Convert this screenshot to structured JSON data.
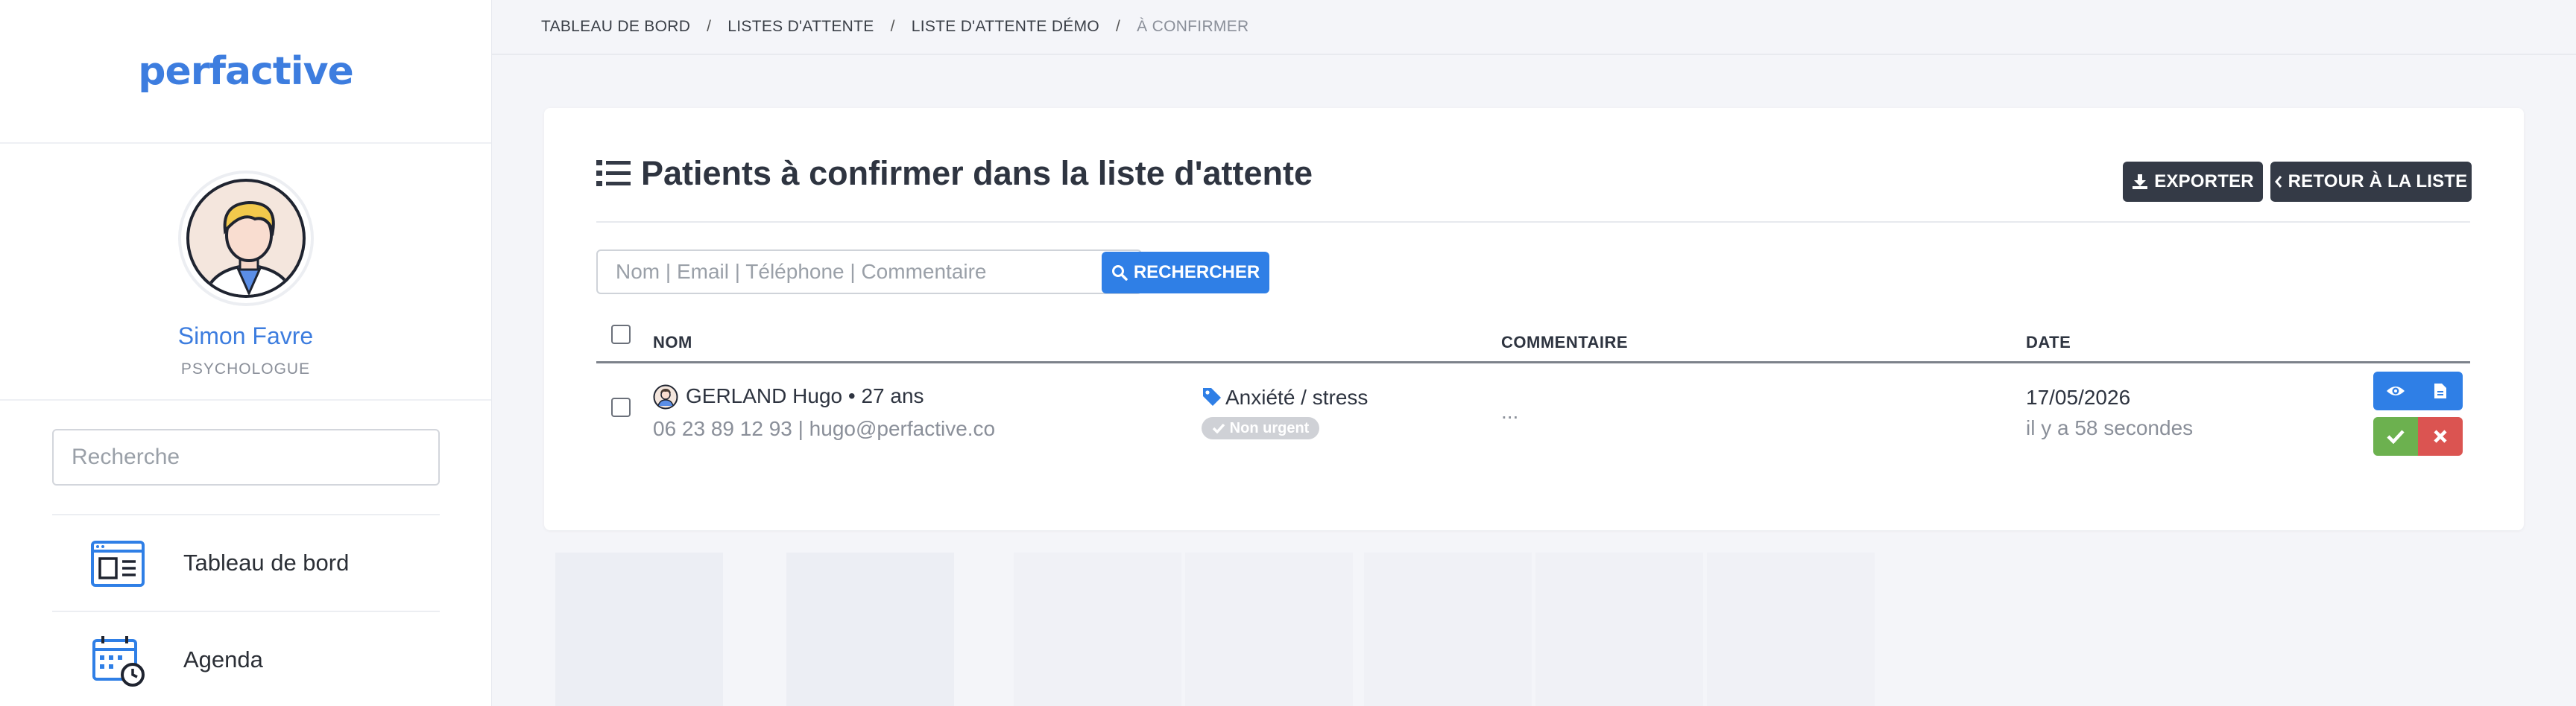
{
  "app": {
    "logo_text": "perfactive",
    "accent_color": "#3d7ddf"
  },
  "sidebar": {
    "user_name": "Simon Favre",
    "user_role": "PSYCHOLOGUE",
    "search_placeholder": "Recherche",
    "items": [
      {
        "label": "Tableau de bord",
        "icon": "dashboard-icon"
      },
      {
        "label": "Agenda",
        "icon": "calendar-clock-icon"
      }
    ]
  },
  "breadcrumb": {
    "items": [
      "TABLEAU DE BORD",
      "LISTES D'ATTENTE",
      "LISTE D'ATTENTE DÉMO",
      "À CONFIRMER"
    ],
    "separator": "/"
  },
  "card": {
    "title": "Patients à confirmer dans la liste d'attente",
    "export_label": "EXPORTER",
    "back_label": "RETOUR À LA LISTE",
    "search_placeholder": "Nom | Email | Téléphone | Commentaire",
    "search_button_label": "RECHERCHER"
  },
  "table": {
    "columns": [
      "NOM",
      "COMMENTAIRE",
      "DATE"
    ],
    "rows": [
      {
        "patient": "GERLAND Hugo • 27 ans",
        "contact": "06 23 89 12 93 | hugo@perfactive.co",
        "tag": "Anxiété / stress",
        "urgency": "Non urgent",
        "comment": "...",
        "date": "17/05/2026",
        "relative_time": "il y a 58 secondes"
      }
    ]
  },
  "colors": {
    "primary_button": "#2f7fe6",
    "dark_button": "#343a46",
    "success": "#6cb14f",
    "danger": "#db5451"
  }
}
